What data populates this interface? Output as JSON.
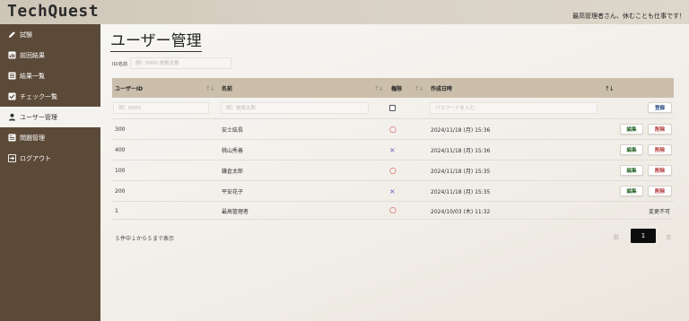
{
  "app": {
    "title": "TechQuest",
    "greeting": "最高管理者さん、休むことも仕事です！"
  },
  "sidebar": {
    "items": [
      {
        "label": "試験",
        "icon": "pencil-icon",
        "active": false
      },
      {
        "label": "前回結果",
        "icon": "bar-chart-icon",
        "active": false
      },
      {
        "label": "結果一覧",
        "icon": "list-icon",
        "active": false
      },
      {
        "label": "チェック一覧",
        "icon": "checkbox-icon",
        "active": false
      },
      {
        "label": "ユーザー管理",
        "icon": "user-icon",
        "active": true
      },
      {
        "label": "問題管理",
        "icon": "document-icon",
        "active": false
      },
      {
        "label": "ログアウト",
        "icon": "logout-icon",
        "active": false
      }
    ]
  },
  "page": {
    "title": "ユーザー管理",
    "filter_label": "ID/名前",
    "filter_placeholder": "例）0000 技術太郎"
  },
  "table": {
    "headers": {
      "user_id": "ユーザーID",
      "name": "名前",
      "permission": "権限",
      "created": "作成日時"
    },
    "new_row": {
      "id_placeholder": "例）0000",
      "name_placeholder": "例）技術太郎",
      "password_placeholder": "パスワードを入力",
      "register_label": "登録"
    },
    "rows": [
      {
        "id": "300",
        "name": "安土紘長",
        "perm": "○",
        "created": "2024/11/18 (月) 15:36"
      },
      {
        "id": "400",
        "name": "桃山秀善",
        "perm": "×",
        "created": "2024/11/18 (月) 15:36"
      },
      {
        "id": "100",
        "name": "鎌倉太郎",
        "perm": "○",
        "created": "2024/11/18 (月) 15:35"
      },
      {
        "id": "200",
        "name": "平安花子",
        "perm": "×",
        "created": "2024/11/18 (月) 15:35"
      },
      {
        "id": "1",
        "name": "最高管理者",
        "perm": "○",
        "created": "2024/10/03 (木) 11:32"
      }
    ],
    "edit_label": "編集",
    "delete_label": "削除",
    "unchangeable_label": "変更不可"
  },
  "pagination": {
    "info": "５件中１から５まで表示",
    "prev": "前",
    "current": "1",
    "next": "次"
  },
  "sort_icons": {
    "default": "↑↓",
    "active": "↑↓"
  },
  "colors": {
    "sidebar": "#5c4a38",
    "header": "#cbbfac",
    "circle": "#d13a3a",
    "cross": "#6a55b8"
  }
}
